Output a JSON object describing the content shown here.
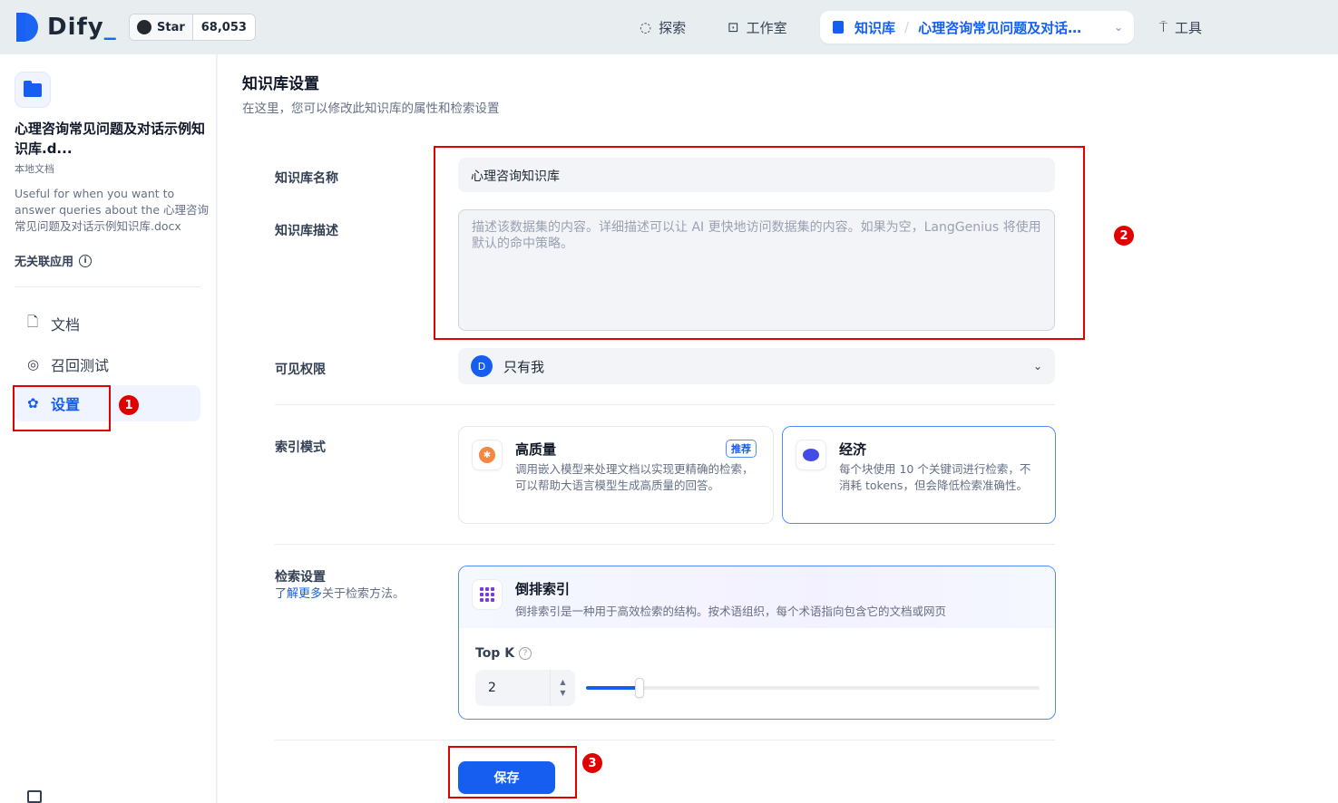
{
  "app": {
    "logo_text": "Dify",
    "logo_underscore": "_"
  },
  "github": {
    "star_label": "Star",
    "star_count": "68,053"
  },
  "nav": {
    "explore": "探索",
    "studio": "工作室",
    "knowledge": "知识库",
    "current_dataset": "心理咨询常见问题及对话…",
    "tools": "工具"
  },
  "sidebar": {
    "dataset_name": "心理咨询常见问题及对话示例知识库.d...",
    "dataset_type": "本地文档",
    "dataset_desc": "Useful for when you want to answer queries about the 心理咨询常见问题及对话示例知识库.docx",
    "related_apps": "无关联应用",
    "items": [
      {
        "label": "文档",
        "icon": "document-icon"
      },
      {
        "label": "召回测试",
        "icon": "target-icon"
      },
      {
        "label": "设置",
        "icon": "gear-icon"
      }
    ]
  },
  "page": {
    "title": "知识库设置",
    "subtitle": "在这里，您可以修改此知识库的属性和检索设置"
  },
  "form": {
    "name_label": "知识库名称",
    "name_value": "心理咨询知识库",
    "desc_label": "知识库描述",
    "desc_placeholder": "描述该数据集的内容。详细描述可以让 AI 更快地访问数据集的内容。如果为空，LangGenius 将使用默认的命中策略。",
    "perm_label": "可见权限",
    "perm_avatar": "D",
    "perm_value": "只有我",
    "index_label": "索引模式",
    "hq_title": "高质量",
    "hq_badge": "推荐",
    "hq_desc": "调用嵌入模型来处理文档以实现更精确的检索，可以帮助大语言模型生成高质量的回答。",
    "eco_title": "经济",
    "eco_desc": "每个块使用 10 个关键词进行检索，不消耗 tokens，但会降低检索准确性。",
    "retrieval_label": "检索设置",
    "retrieval_link": "了解更多",
    "retrieval_sub": "关于检索方法。",
    "inverted_title": "倒排索引",
    "inverted_desc": "倒排索引是一种用于高效检索的结构。按术语组织，每个术语指向包含它的文档或网页",
    "topk_label": "Top K",
    "topk_value": "2",
    "save_label": "保存"
  },
  "annotations": {
    "one": "1",
    "two": "2",
    "three": "3",
    "color": "#e00000"
  }
}
